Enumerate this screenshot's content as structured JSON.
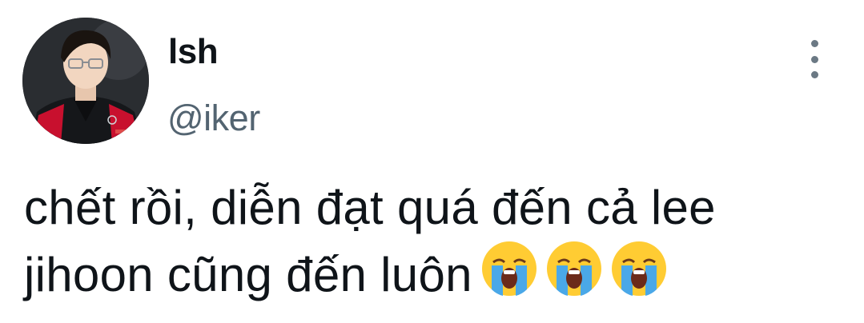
{
  "user": {
    "display_name": "lsh",
    "handle": "@iker"
  },
  "avatar": {
    "icon": "avatar-photo",
    "jersey_color": "#c8102e"
  },
  "menu": {
    "icon": "more-vertical-icon"
  },
  "tweet": {
    "text": "chết rồi, diễn đạt quá đến cả lee jihoon cũng đến luôn",
    "emojis": [
      "loudly-crying-face-emoji",
      "loudly-crying-face-emoji",
      "loudly-crying-face-emoji"
    ]
  },
  "colors": {
    "text": "#0f1419",
    "secondary": "#536471",
    "emoji_yellow": "#ffcc33",
    "emoji_tears": "#4aa8e8"
  }
}
